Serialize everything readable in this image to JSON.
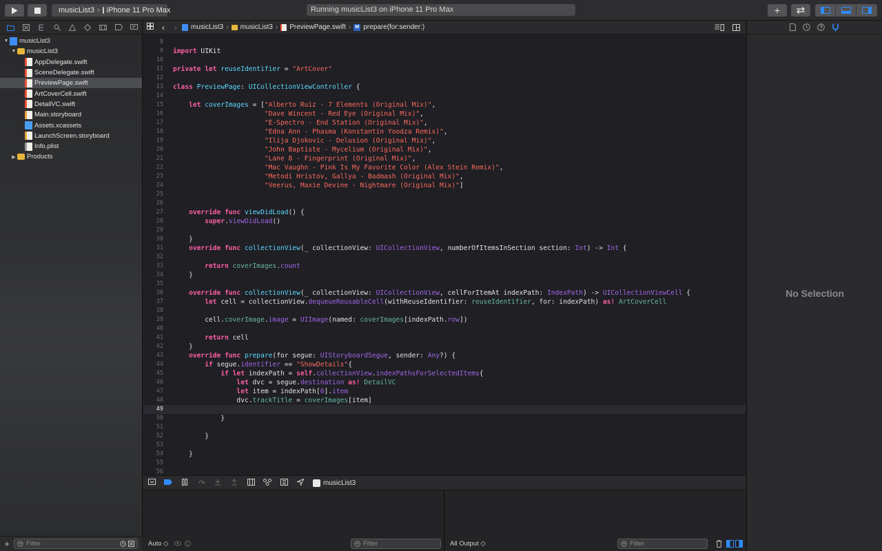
{
  "toolbar": {
    "scheme_target": "musicList3",
    "device": "iPhone 11 Pro Max",
    "activity_status": "Running musicList3 on iPhone 11 Pro Max"
  },
  "navigator": {
    "items": [
      {
        "label": "musicList3",
        "type": "proj",
        "level": 0,
        "disclosure": "open"
      },
      {
        "label": "musicList3",
        "type": "folder",
        "level": 1,
        "disclosure": "open"
      },
      {
        "label": "AppDelegate.swift",
        "type": "swift",
        "level": 2
      },
      {
        "label": "SceneDelegate.swift",
        "type": "swift",
        "level": 2
      },
      {
        "label": "PreviewPage.swift",
        "type": "swift",
        "level": 2,
        "selected": true
      },
      {
        "label": "ArtCoverCell.swift",
        "type": "swift",
        "level": 2
      },
      {
        "label": "DetailVC.swift",
        "type": "swift",
        "level": 2
      },
      {
        "label": "Main.storyboard",
        "type": "sb",
        "level": 2
      },
      {
        "label": "Assets.xcassets",
        "type": "assets",
        "level": 2
      },
      {
        "label": "LaunchScreen.storyboard",
        "type": "sb",
        "level": 2
      },
      {
        "label": "Info.plist",
        "type": "plist",
        "level": 2
      },
      {
        "label": "Products",
        "type": "folder",
        "level": 1,
        "disclosure": "closed"
      }
    ],
    "filter_placeholder": "Filter"
  },
  "jumpbar": {
    "crumbs": [
      "musicList3",
      "musicList3",
      "PreviewPage.swift",
      "prepare(for:sender:)"
    ],
    "method_badge": "M"
  },
  "editor": {
    "current_line": 49,
    "lines": [
      {
        "n": 8,
        "t": [
          [
            "pl",
            ""
          ]
        ]
      },
      {
        "n": 9,
        "t": [
          [
            "kw",
            "import"
          ],
          [
            "pl",
            " UIKit"
          ]
        ]
      },
      {
        "n": 10,
        "t": [
          [
            "pl",
            ""
          ]
        ]
      },
      {
        "n": 11,
        "t": [
          [
            "kw",
            "private let"
          ],
          [
            "pl",
            " "
          ],
          [
            "ty",
            "reuseIdentifier"
          ],
          [
            "pl",
            " = "
          ],
          [
            "str",
            "\"ArtCover\""
          ]
        ]
      },
      {
        "n": 12,
        "t": [
          [
            "pl",
            ""
          ]
        ]
      },
      {
        "n": 13,
        "t": [
          [
            "kw",
            "class"
          ],
          [
            "pl",
            " "
          ],
          [
            "ty",
            "PreviewPage"
          ],
          [
            "pl",
            ": "
          ],
          [
            "ty",
            "UICollectionViewController"
          ],
          [
            "pl",
            " {"
          ]
        ]
      },
      {
        "n": 14,
        "t": [
          [
            "pl",
            ""
          ]
        ]
      },
      {
        "n": 15,
        "t": [
          [
            "pl",
            "    "
          ],
          [
            "kw",
            "let"
          ],
          [
            "pl",
            " "
          ],
          [
            "ty",
            "coverImages"
          ],
          [
            "pl",
            " = ["
          ],
          [
            "str",
            "\"Alberto Ruiz - 7 Elements (Original Mix)\""
          ],
          [
            "pl",
            ","
          ]
        ]
      },
      {
        "n": 16,
        "t": [
          [
            "pl",
            "                       "
          ],
          [
            "str",
            "\"Dave Wincent - Red Eye (Original Mix)\""
          ],
          [
            "pl",
            ","
          ]
        ]
      },
      {
        "n": 17,
        "t": [
          [
            "pl",
            "                       "
          ],
          [
            "str",
            "\"E-Spectro - End Station (Original Mix)\""
          ],
          [
            "pl",
            ","
          ]
        ]
      },
      {
        "n": 18,
        "t": [
          [
            "pl",
            "                       "
          ],
          [
            "str",
            "\"Edna Ann - Phasma (Konstantin Yoodza Remix)\""
          ],
          [
            "pl",
            ","
          ]
        ]
      },
      {
        "n": 19,
        "t": [
          [
            "pl",
            "                       "
          ],
          [
            "str",
            "\"Ilija Djokovic - Delusion (Original Mix)\""
          ],
          [
            "pl",
            ","
          ]
        ]
      },
      {
        "n": 20,
        "t": [
          [
            "pl",
            "                       "
          ],
          [
            "str",
            "\"John Baptiste - Mycelium (Original Mix)\""
          ],
          [
            "pl",
            ","
          ]
        ]
      },
      {
        "n": 21,
        "t": [
          [
            "pl",
            "                       "
          ],
          [
            "str",
            "\"Lane 8 - Fingerprint (Original Mix)\""
          ],
          [
            "pl",
            ","
          ]
        ]
      },
      {
        "n": 22,
        "t": [
          [
            "pl",
            "                       "
          ],
          [
            "str",
            "\"Mac Vaughn - Pink Is My Favorite Color (Alex Stein Remix)\""
          ],
          [
            "pl",
            ","
          ]
        ]
      },
      {
        "n": 23,
        "t": [
          [
            "pl",
            "                       "
          ],
          [
            "str",
            "\"Metodi Hristov, Gallya - Badmash (Original Mix)\""
          ],
          [
            "pl",
            ","
          ]
        ]
      },
      {
        "n": 24,
        "t": [
          [
            "pl",
            "                       "
          ],
          [
            "str",
            "\"Veerus, Maxie Devine - Nightmare (Original Mix)\""
          ],
          [
            "pl",
            "]"
          ]
        ]
      },
      {
        "n": 25,
        "t": [
          [
            "pl",
            ""
          ]
        ]
      },
      {
        "n": 26,
        "t": [
          [
            "pl",
            ""
          ]
        ]
      },
      {
        "n": 27,
        "t": [
          [
            "pl",
            "    "
          ],
          [
            "kw",
            "override func"
          ],
          [
            "pl",
            " "
          ],
          [
            "ty",
            "viewDidLoad"
          ],
          [
            "pl",
            "() {"
          ]
        ]
      },
      {
        "n": 28,
        "t": [
          [
            "pl",
            "        "
          ],
          [
            "kw",
            "super"
          ],
          [
            "pl",
            "."
          ],
          [
            "fn",
            "viewDidLoad"
          ],
          [
            "pl",
            "()"
          ]
        ]
      },
      {
        "n": 29,
        "t": [
          [
            "pl",
            ""
          ]
        ]
      },
      {
        "n": 30,
        "t": [
          [
            "pl",
            "    }"
          ]
        ]
      },
      {
        "n": 31,
        "t": [
          [
            "pl",
            "    "
          ],
          [
            "kw",
            "override func"
          ],
          [
            "pl",
            " "
          ],
          [
            "ty",
            "collectionView"
          ],
          [
            "pl",
            "(_ collectionView: "
          ],
          [
            "fn",
            "UICollectionView"
          ],
          [
            "pl",
            ", numberOfItemsInSection section: "
          ],
          [
            "fn",
            "Int"
          ],
          [
            "pl",
            ") -> "
          ],
          [
            "fn",
            "Int"
          ],
          [
            "pl",
            " {"
          ]
        ]
      },
      {
        "n": 32,
        "t": [
          [
            "pl",
            ""
          ]
        ]
      },
      {
        "n": 33,
        "t": [
          [
            "pl",
            "        "
          ],
          [
            "kw",
            "return"
          ],
          [
            "pl",
            " "
          ],
          [
            "pr",
            "coverImages"
          ],
          [
            "pl",
            "."
          ],
          [
            "fn",
            "count"
          ]
        ]
      },
      {
        "n": 34,
        "t": [
          [
            "pl",
            "    }"
          ]
        ]
      },
      {
        "n": 35,
        "t": [
          [
            "pl",
            ""
          ]
        ]
      },
      {
        "n": 36,
        "t": [
          [
            "pl",
            "    "
          ],
          [
            "kw",
            "override func"
          ],
          [
            "pl",
            " "
          ],
          [
            "ty",
            "collectionView"
          ],
          [
            "pl",
            "(_ collectionView: "
          ],
          [
            "fn",
            "UICollectionView"
          ],
          [
            "pl",
            ", cellForItemAt indexPath: "
          ],
          [
            "fn",
            "IndexPath"
          ],
          [
            "pl",
            ") -> "
          ],
          [
            "fn",
            "UICollectionViewCell"
          ],
          [
            "pl",
            " {"
          ]
        ]
      },
      {
        "n": 37,
        "t": [
          [
            "pl",
            "        "
          ],
          [
            "kw",
            "let"
          ],
          [
            "pl",
            " cell = collectionView."
          ],
          [
            "fn",
            "dequeueReusableCell"
          ],
          [
            "pl",
            "(withReuseIdentifier: "
          ],
          [
            "pr",
            "reuseIdentifier"
          ],
          [
            "pl",
            ", for: indexPath) "
          ],
          [
            "kw",
            "as!"
          ],
          [
            "pl",
            " "
          ],
          [
            "pr",
            "ArtCoverCell"
          ]
        ]
      },
      {
        "n": 38,
        "t": [
          [
            "pl",
            ""
          ]
        ]
      },
      {
        "n": 39,
        "t": [
          [
            "pl",
            "        cell."
          ],
          [
            "pr",
            "coverImage"
          ],
          [
            "pl",
            "."
          ],
          [
            "fn",
            "image"
          ],
          [
            "pl",
            " = "
          ],
          [
            "fn",
            "UIImage"
          ],
          [
            "pl",
            "(named: "
          ],
          [
            "pr",
            "coverImages"
          ],
          [
            "pl",
            "[indexPath."
          ],
          [
            "fn",
            "row"
          ],
          [
            "pl",
            "])"
          ]
        ]
      },
      {
        "n": 40,
        "t": [
          [
            "pl",
            ""
          ]
        ]
      },
      {
        "n": 41,
        "t": [
          [
            "pl",
            "        "
          ],
          [
            "kw",
            "return"
          ],
          [
            "pl",
            " cell"
          ]
        ]
      },
      {
        "n": 42,
        "t": [
          [
            "pl",
            "    }"
          ]
        ]
      },
      {
        "n": 43,
        "t": [
          [
            "pl",
            "    "
          ],
          [
            "kw",
            "override func"
          ],
          [
            "pl",
            " "
          ],
          [
            "ty",
            "prepare"
          ],
          [
            "pl",
            "(for segue: "
          ],
          [
            "fn",
            "UIStoryboardSegue"
          ],
          [
            "pl",
            ", sender: "
          ],
          [
            "fn",
            "Any"
          ],
          [
            "pl",
            "?) {"
          ]
        ]
      },
      {
        "n": 44,
        "t": [
          [
            "pl",
            "        "
          ],
          [
            "kw",
            "if"
          ],
          [
            "pl",
            " segue."
          ],
          [
            "fn",
            "identifier"
          ],
          [
            "pl",
            " == "
          ],
          [
            "str",
            "\"ShowDetails\""
          ],
          [
            "pl",
            "{"
          ]
        ]
      },
      {
        "n": 45,
        "t": [
          [
            "pl",
            "            "
          ],
          [
            "kw",
            "if let"
          ],
          [
            "pl",
            " indexPath = "
          ],
          [
            "kw",
            "self"
          ],
          [
            "pl",
            "."
          ],
          [
            "fn",
            "collectionView"
          ],
          [
            "pl",
            "."
          ],
          [
            "fn",
            "indexPathsForSelectedItems"
          ],
          [
            "pl",
            "{"
          ]
        ]
      },
      {
        "n": 46,
        "t": [
          [
            "pl",
            "                "
          ],
          [
            "kw",
            "let"
          ],
          [
            "pl",
            " dvc = segue."
          ],
          [
            "fn",
            "destination"
          ],
          [
            "pl",
            " "
          ],
          [
            "kw",
            "as!"
          ],
          [
            "pl",
            " "
          ],
          [
            "pr",
            "DetailVC"
          ]
        ]
      },
      {
        "n": 47,
        "t": [
          [
            "pl",
            "                "
          ],
          [
            "kw",
            "let"
          ],
          [
            "pl",
            " item = indexPath["
          ],
          [
            "fn",
            "0"
          ],
          [
            "pl",
            "]."
          ],
          [
            "fn",
            "item"
          ]
        ]
      },
      {
        "n": 48,
        "t": [
          [
            "pl",
            "                dvc."
          ],
          [
            "pr",
            "trackTitle"
          ],
          [
            "pl",
            " = "
          ],
          [
            "pr",
            "coverImages"
          ],
          [
            "pl",
            "[item]"
          ]
        ]
      },
      {
        "n": 49,
        "t": [
          [
            "pl",
            ""
          ]
        ]
      },
      {
        "n": 50,
        "t": [
          [
            "pl",
            "            }"
          ]
        ]
      },
      {
        "n": 51,
        "t": [
          [
            "pl",
            ""
          ]
        ]
      },
      {
        "n": 52,
        "t": [
          [
            "pl",
            "        }"
          ]
        ]
      },
      {
        "n": 53,
        "t": [
          [
            "pl",
            ""
          ]
        ]
      },
      {
        "n": 54,
        "t": [
          [
            "pl",
            "    }"
          ]
        ]
      },
      {
        "n": 55,
        "t": [
          [
            "pl",
            ""
          ]
        ]
      },
      {
        "n": 56,
        "t": [
          [
            "pl",
            ""
          ]
        ]
      }
    ]
  },
  "debug": {
    "process_name": "musicList3",
    "auto_label": "Auto ◇",
    "vars_filter_placeholder": "Filter",
    "output_label": "All Output ◇",
    "console_filter_placeholder": "Filter"
  },
  "inspector": {
    "empty_message": "No Selection"
  },
  "colors": {
    "accent": "#2f8cff",
    "keyword": "#fc5fa3",
    "string": "#fc6a5d",
    "type": "#5dd8ff",
    "property": "#67b7a4",
    "function": "#a167e6"
  }
}
